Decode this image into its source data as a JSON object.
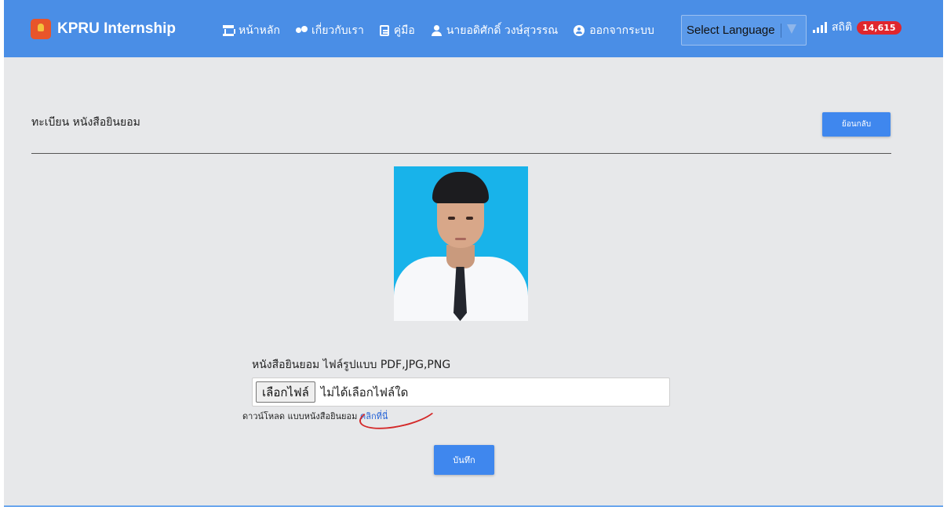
{
  "navbar": {
    "brand": "KPRU Internship",
    "items": [
      {
        "label": "หน้าหลัก",
        "icon": "home-icon"
      },
      {
        "label": "เกี่ยวกับเรา",
        "icon": "users-icon"
      },
      {
        "label": "คู่มือ",
        "icon": "document-icon"
      },
      {
        "label": "นายอดิศักดิ์ วงษ์สุวรรณ",
        "icon": "user-icon"
      },
      {
        "label": "ออกจากระบบ",
        "icon": "logout-icon"
      }
    ],
    "language_select": "Select Language",
    "stats_label": "สถิติ",
    "stats_count": "14,615"
  },
  "page": {
    "title": "ทะเบียน หนังสือยินยอม",
    "back_label": "ย้อนกลับ"
  },
  "upload": {
    "label": "หนังสือยินยอม ไฟล์รูปแบบ PDF,JPG,PNG",
    "choose_file_label": "เลือกไฟล์",
    "file_status": "ไม่ได้เลือกไฟล์ใด",
    "download_text": "ดาวน์โหลด แบบหนังสือยินยอม",
    "download_link": "คลิกที่นี่"
  },
  "save_label": "บันทึก",
  "colors": {
    "navbar": "#4a8ee6",
    "button": "#3f87ee",
    "badge": "#e0262d",
    "annotation": "#d42a2a"
  }
}
